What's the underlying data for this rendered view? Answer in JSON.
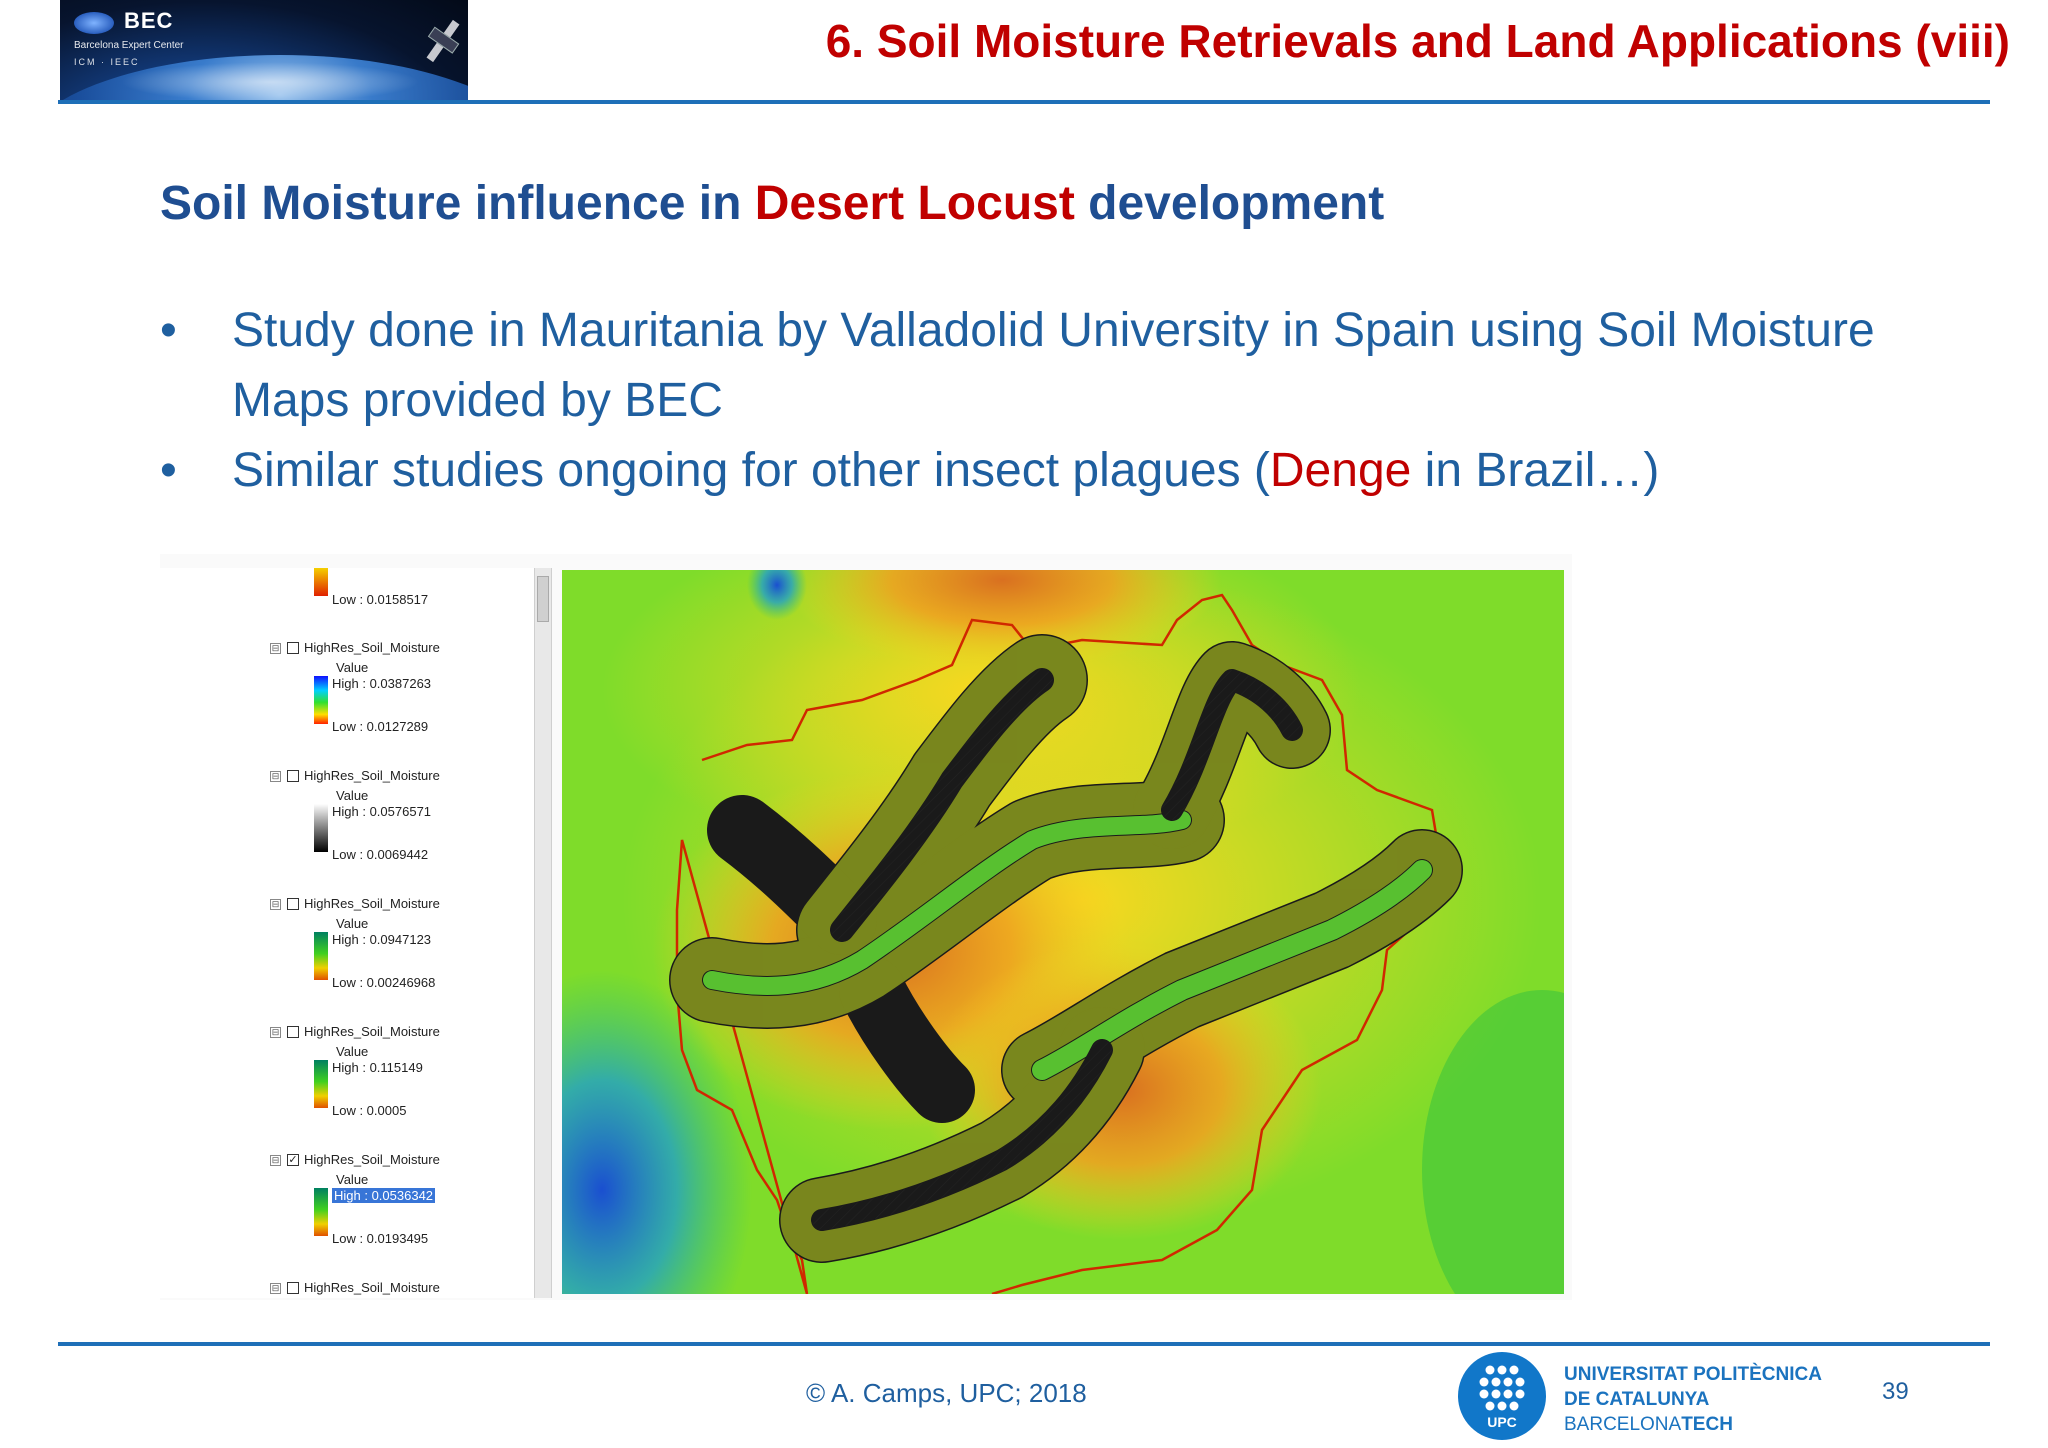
{
  "header": {
    "logo_title": "BEC",
    "logo_subtitle": "Barcelona Expert Center",
    "logo_partners": "ICM · IEEC",
    "title": "6. Soil Moisture Retrievals and Land Applications (viii)"
  },
  "subtitle": {
    "part1": "Soil Moisture influence in ",
    "highlight": "Desert Locust",
    "part2": " development"
  },
  "bullets": [
    {
      "marker": "•",
      "text": "Study done in Mauritania by Valladolid University in Spain using Soil Moisture Maps provided by BEC"
    },
    {
      "marker": "•",
      "text_before": "Similar studies ongoing for other insect plagues (",
      "highlight": "Denge",
      "text_after": " in Brazil…)"
    }
  ],
  "legend": {
    "top_low": "Low : 0.0158517",
    "layers": [
      {
        "name": "HighRes_Soil_Moisture",
        "value_label": "Value",
        "high": "High : 0.0387263",
        "low": "Low : 0.0127289",
        "checked": false,
        "expander": "⊟",
        "ramp": "rainbow"
      },
      {
        "name": "HighRes_Soil_Moisture",
        "value_label": "Value",
        "high": "High : 0.0576571",
        "low": "Low : 0.0069442",
        "checked": false,
        "expander": "⊟",
        "ramp": "gray"
      },
      {
        "name": "HighRes_Soil_Moisture",
        "value_label": "Value",
        "high": "High : 0.0947123",
        "low": "Low : 0.00246968",
        "checked": false,
        "expander": "⊟",
        "ramp": "green-orange"
      },
      {
        "name": "HighRes_Soil_Moisture",
        "value_label": "Value",
        "high": "High : 0.115149",
        "low": "Low : 0.0005",
        "checked": false,
        "expander": "⊟",
        "ramp": "green-orange"
      },
      {
        "name": "HighRes_Soil_Moisture",
        "value_label": "Value",
        "high": "High : 0.0536342",
        "low": "Low : 0.0193495",
        "checked": true,
        "expander": "⊟",
        "ramp": "green-orange",
        "selected": true
      },
      {
        "name": "HighRes_Soil_Moisture",
        "checked": false,
        "expander": "⊟"
      }
    ]
  },
  "footer": {
    "copyright": "© A. Camps, UPC; 2018",
    "upc_mark": "UPC",
    "upc_line1": "UNIVERSITAT POLITÈCNICA",
    "upc_line2": "DE CATALUNYA",
    "upc_line3a": "BARCELONA",
    "upc_line3b": "TECH",
    "page_number": "39"
  },
  "colors": {
    "title_red": "#c00000",
    "subtitle_blue": "#1f4e91",
    "bullet_blue": "#1f5f9f",
    "rule_blue": "#1e6fb8",
    "upc_blue": "#1177c9"
  }
}
